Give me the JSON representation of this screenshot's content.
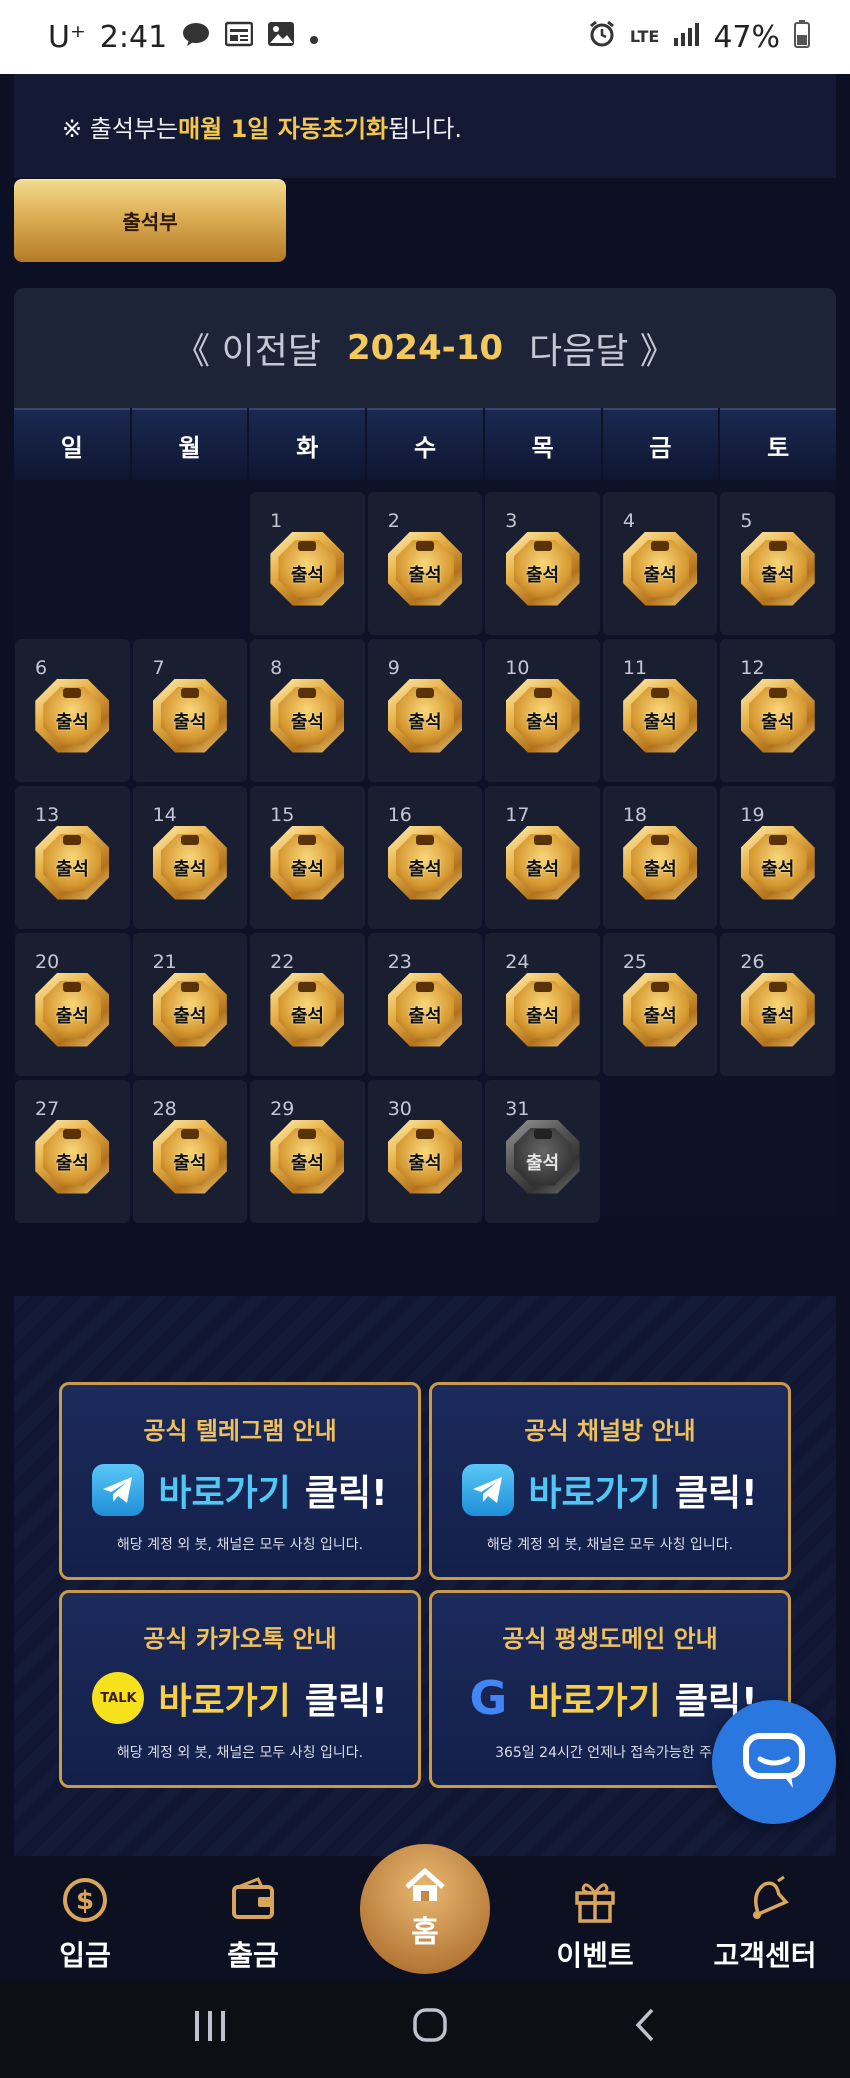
{
  "status_bar": {
    "carrier": "U⁺",
    "time": "2:41",
    "left_icons": [
      "chat-bubble-icon",
      "calendar-news-icon",
      "image-icon",
      "dot-icon"
    ],
    "network": "LTE",
    "battery": "47%"
  },
  "notice": {
    "prefix": "※ 출석부는 ",
    "highlight": "매월 1일 자동초기화",
    "suffix": "됩니다."
  },
  "attendance_button": {
    "label": "출석부"
  },
  "calendar": {
    "prev_label": "《 이전달",
    "current": "2024-10",
    "next_label": "다음달 》",
    "weekdays": [
      "일",
      "월",
      "화",
      "수",
      "목",
      "금",
      "토"
    ],
    "leading_empty": 2,
    "badge_text": "출석",
    "days": [
      {
        "n": "1",
        "attended": true
      },
      {
        "n": "2",
        "attended": true
      },
      {
        "n": "3",
        "attended": true
      },
      {
        "n": "4",
        "attended": true
      },
      {
        "n": "5",
        "attended": true
      },
      {
        "n": "6",
        "attended": true
      },
      {
        "n": "7",
        "attended": true
      },
      {
        "n": "8",
        "attended": true
      },
      {
        "n": "9",
        "attended": true
      },
      {
        "n": "10",
        "attended": true
      },
      {
        "n": "11",
        "attended": true
      },
      {
        "n": "12",
        "attended": true
      },
      {
        "n": "13",
        "attended": true
      },
      {
        "n": "14",
        "attended": true
      },
      {
        "n": "15",
        "attended": true
      },
      {
        "n": "16",
        "attended": true
      },
      {
        "n": "17",
        "attended": true
      },
      {
        "n": "18",
        "attended": true
      },
      {
        "n": "19",
        "attended": true
      },
      {
        "n": "20",
        "attended": true
      },
      {
        "n": "21",
        "attended": true
      },
      {
        "n": "22",
        "attended": true
      },
      {
        "n": "23",
        "attended": true
      },
      {
        "n": "24",
        "attended": true
      },
      {
        "n": "25",
        "attended": true
      },
      {
        "n": "26",
        "attended": true
      },
      {
        "n": "27",
        "attended": true
      },
      {
        "n": "28",
        "attended": true
      },
      {
        "n": "29",
        "attended": true
      },
      {
        "n": "30",
        "attended": true
      },
      {
        "n": "31",
        "attended": false
      }
    ]
  },
  "links": [
    {
      "title": "공식 텔레그램 안내",
      "cta_a": "바로가기",
      "cta_b": "클릭!",
      "sub": "해당 계정 외 봇, 채널은 모두 사칭 입니다.",
      "icon": "telegram-icon"
    },
    {
      "title": "공식 채널방 안내",
      "cta_a": "바로가기",
      "cta_b": "클릭!",
      "sub": "해당 계정 외 봇, 채널은 모두 사칭 입니다.",
      "icon": "telegram-icon"
    },
    {
      "title": "공식 카카오톡 안내",
      "cta_a": "바로가기",
      "cta_b": "클릭!",
      "sub": "해당 계정 외 봇, 채널은 모두 사칭 입니다.",
      "icon": "kakaotalk-icon",
      "icon_text": "TALK"
    },
    {
      "title": "공식 평생도메인 안내",
      "cta_a": "바로가기",
      "cta_b": "클릭!",
      "sub": "365일 24시간 언제나 접속가능한 주소",
      "icon": "google-icon",
      "icon_text": "G"
    }
  ],
  "bottom_nav": {
    "deposit": "입금",
    "withdraw": "출금",
    "home": "홈",
    "event": "이벤트",
    "support": "고객센터"
  },
  "colors": {
    "background": "#0c1024",
    "gold": "#f3c95b",
    "card_border": "#c89a4a",
    "chat_blue": "#2a77e0"
  }
}
